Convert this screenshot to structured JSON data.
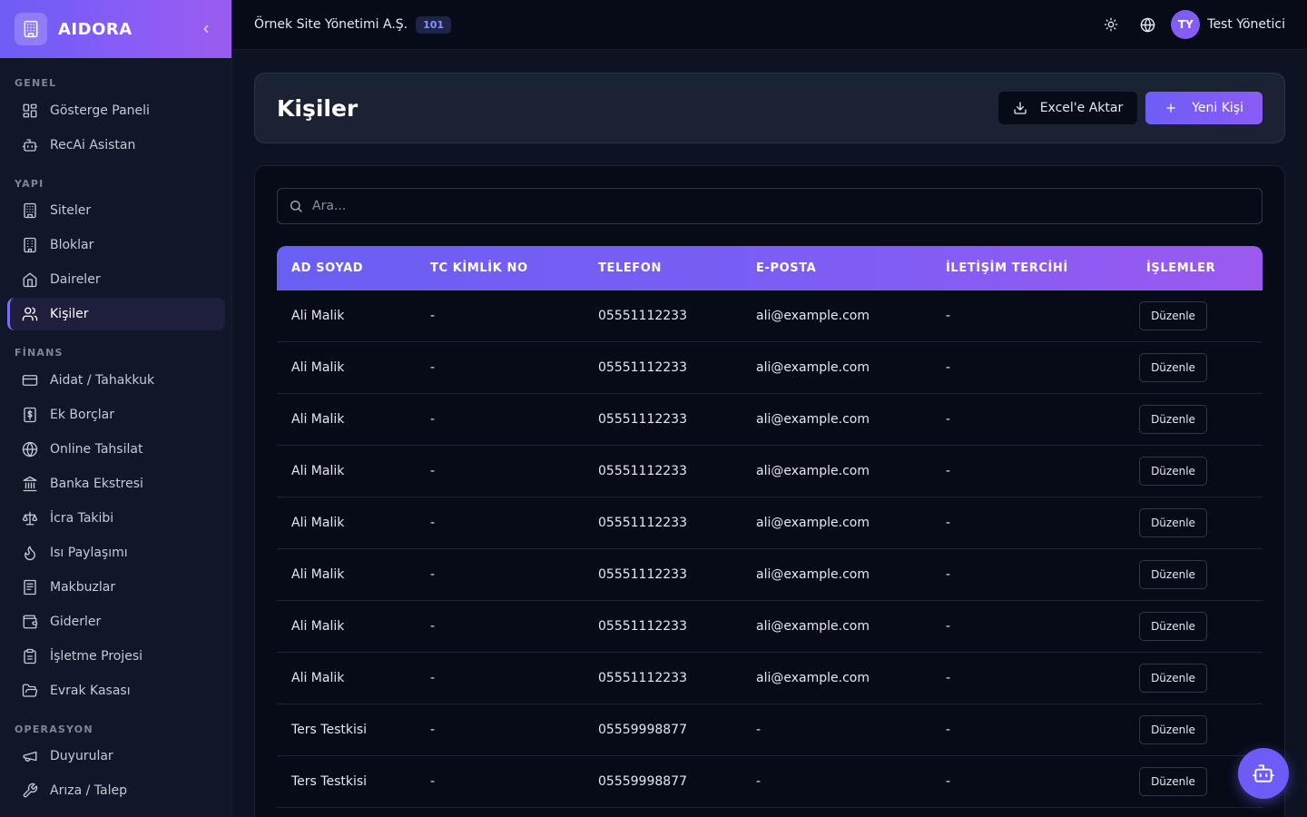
{
  "brand": {
    "name": "AIDORA"
  },
  "sidebar": {
    "sections": [
      {
        "title": "GENEL",
        "items": [
          {
            "label": "Gösterge Paneli",
            "icon": "dashboard-icon"
          },
          {
            "label": "RecAi Asistan",
            "icon": "bot-icon"
          }
        ]
      },
      {
        "title": "YAPI",
        "items": [
          {
            "label": "Siteler",
            "icon": "building-icon"
          },
          {
            "label": "Bloklar",
            "icon": "block-icon"
          },
          {
            "label": "Daireler",
            "icon": "home-icon"
          },
          {
            "label": "Kişiler",
            "icon": "users-icon",
            "active": true
          }
        ]
      },
      {
        "title": "FİNANS",
        "items": [
          {
            "label": "Aidat / Tahakkuk",
            "icon": "credit-card-icon"
          },
          {
            "label": "Ek Borçlar",
            "icon": "dollar-receipt-icon"
          },
          {
            "label": "Online Tahsilat",
            "icon": "globe-icon"
          },
          {
            "label": "Banka Ekstresi",
            "icon": "bank-icon"
          },
          {
            "label": "İcra Takibi",
            "icon": "scale-icon"
          },
          {
            "label": "Isı Paylaşımı",
            "icon": "flame-icon"
          },
          {
            "label": "Makbuzlar",
            "icon": "receipt-icon"
          },
          {
            "label": "Giderler",
            "icon": "wallet-icon"
          },
          {
            "label": "İşletme Projesi",
            "icon": "clipboard-icon"
          },
          {
            "label": "Evrak Kasası",
            "icon": "folder-open-icon"
          }
        ]
      },
      {
        "title": "OPERASYON",
        "items": [
          {
            "label": "Duyurular",
            "icon": "megaphone-icon"
          },
          {
            "label": "Arıza / Talep",
            "icon": "wrench-icon"
          }
        ]
      }
    ]
  },
  "topbar": {
    "org_name": "Örnek Site Yönetimi A.Ş.",
    "org_badge": "101",
    "user_initials": "TY",
    "user_name": "Test Yönetici"
  },
  "page": {
    "title": "Kişiler",
    "export_label": "Excel'e Aktar",
    "new_label": "Yeni Kişi",
    "search_placeholder": "Ara..."
  },
  "table": {
    "columns": [
      "AD SOYAD",
      "TC KİMLİK NO",
      "TELEFON",
      "E-POSTA",
      "İLETİŞİM TERCİHİ",
      "İŞLEMLER"
    ],
    "rows": [
      {
        "name": "Ali Malik",
        "tc": "-",
        "phone": "05551112233",
        "email": "ali@example.com",
        "pref": "-",
        "action": "Düzenle"
      },
      {
        "name": "Ali Malik",
        "tc": "-",
        "phone": "05551112233",
        "email": "ali@example.com",
        "pref": "-",
        "action": "Düzenle"
      },
      {
        "name": "Ali Malik",
        "tc": "-",
        "phone": "05551112233",
        "email": "ali@example.com",
        "pref": "-",
        "action": "Düzenle"
      },
      {
        "name": "Ali Malik",
        "tc": "-",
        "phone": "05551112233",
        "email": "ali@example.com",
        "pref": "-",
        "action": "Düzenle"
      },
      {
        "name": "Ali Malik",
        "tc": "-",
        "phone": "05551112233",
        "email": "ali@example.com",
        "pref": "-",
        "action": "Düzenle"
      },
      {
        "name": "Ali Malik",
        "tc": "-",
        "phone": "05551112233",
        "email": "ali@example.com",
        "pref": "-",
        "action": "Düzenle"
      },
      {
        "name": "Ali Malik",
        "tc": "-",
        "phone": "05551112233",
        "email": "ali@example.com",
        "pref": "-",
        "action": "Düzenle"
      },
      {
        "name": "Ali Malik",
        "tc": "-",
        "phone": "05551112233",
        "email": "ali@example.com",
        "pref": "-",
        "action": "Düzenle"
      },
      {
        "name": "Ters Testkisi",
        "tc": "-",
        "phone": "05559998877",
        "email": "-",
        "pref": "-",
        "action": "Düzenle"
      },
      {
        "name": "Ters Testkisi",
        "tc": "-",
        "phone": "05559998877",
        "email": "-",
        "pref": "-",
        "action": "Düzenle"
      }
    ]
  },
  "colors": {
    "accent": "#6d5df6",
    "accent_end": "#8b5cf6",
    "bg": "#060b17",
    "sidebar": "#0f1729"
  }
}
